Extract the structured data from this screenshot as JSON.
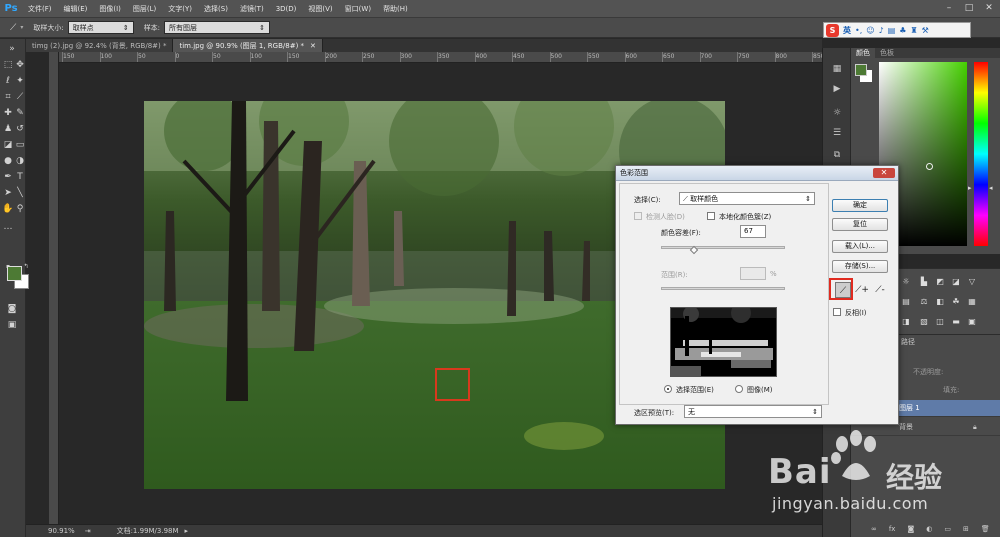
{
  "app": {
    "logo": "Ps"
  },
  "menu": [
    "文件(F)",
    "编辑(E)",
    "图像(I)",
    "图层(L)",
    "文字(Y)",
    "选择(S)",
    "滤镜(T)",
    "3D(D)",
    "视图(V)",
    "窗口(W)",
    "帮助(H)"
  ],
  "options_bar": {
    "sample_size_label": "取样大小:",
    "sample_size_value": "取样点",
    "sample_label": "样本:",
    "sample_value": "所有图层"
  },
  "ime_bar": {
    "mode": "英"
  },
  "tabs": [
    {
      "label": "timg (2).jpg @ 92.4% (背景, RGB/8#) *",
      "active": false
    },
    {
      "label": "tim.jpg @ 90.9% (图层 1, RGB/8#) *",
      "active": true
    }
  ],
  "ruler_ticks": [
    "150",
    "100",
    "50",
    "0",
    "50",
    "100",
    "150",
    "200",
    "250",
    "300",
    "350",
    "400",
    "450",
    "500",
    "550",
    "600",
    "650",
    "700",
    "750",
    "800",
    "850"
  ],
  "status_bar": {
    "zoom": "90.91%",
    "doc_size": "文档:1.99M/3.98M"
  },
  "colors": {
    "foreground": "#4d7a34",
    "background": "#ffffff",
    "accent_red": "#e02b20",
    "layer_selected": "#5f7ba8"
  },
  "color_panel": {
    "tabs": [
      "颜色",
      "色板"
    ]
  },
  "layers_panel": {
    "tab": "路径",
    "opacity_label": "不透明度:",
    "fill_label": "填充:",
    "layers": [
      {
        "name": "图层 1",
        "selected": true
      },
      {
        "name": "背景",
        "selected": false
      }
    ]
  },
  "dialog": {
    "title": "色彩范围",
    "select_label": "选择(C):",
    "select_value": "取样颜色",
    "detect_faces_label": "检测人脸(D)",
    "localized_label": "本地化颜色簇(Z)",
    "fuzziness_label": "颜色容差(F):",
    "fuzziness_value": "67",
    "fuzziness_fraction": 0.27,
    "range_label": "范围(R):",
    "range_unit": "%",
    "radio_selection": "选择范围(E)",
    "radio_image": "图像(M)",
    "preview_label": "选区预览(T):",
    "preview_value": "无",
    "buttons": {
      "ok": "确定",
      "reset": "复位",
      "load": "载入(L)...",
      "save": "存储(S)..."
    },
    "invert_label": "反相(I)"
  },
  "watermark": {
    "brand_text": "Bai",
    "suffix_text": "经验",
    "url": "jingyan.baidu.com"
  }
}
